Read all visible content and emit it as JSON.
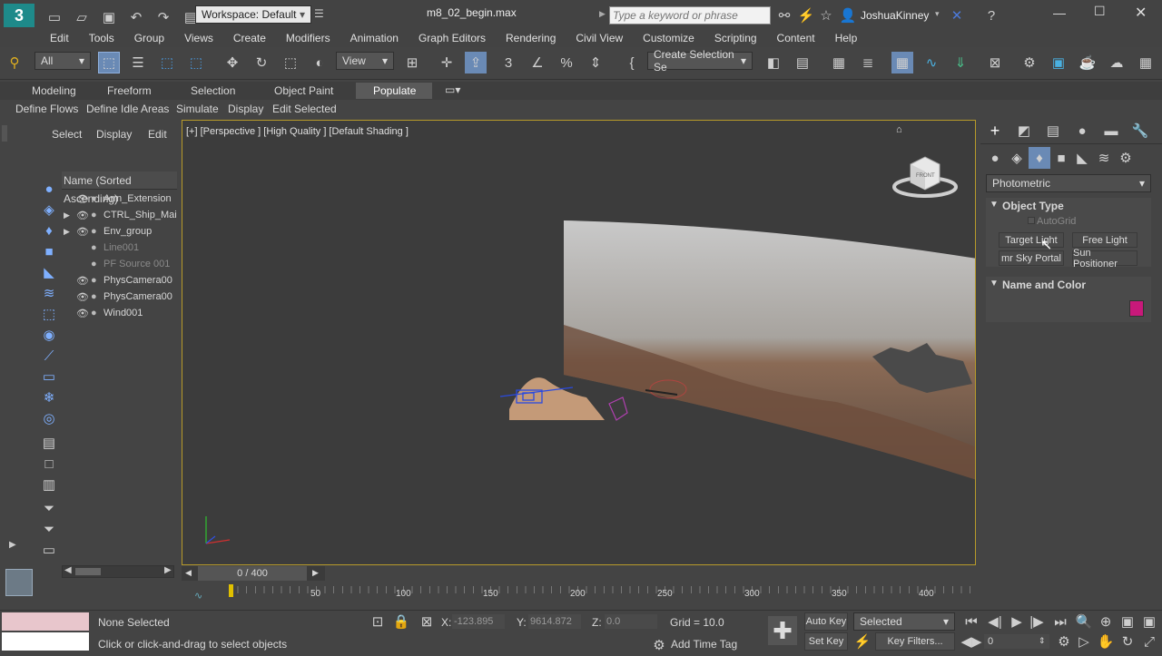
{
  "titlebar": {
    "workspace": "Workspace: Default",
    "file_title": "m8_02_begin.max",
    "search_placeholder": "Type a keyword or phrase",
    "user": "JoshuaKinney"
  },
  "menu": [
    "Edit",
    "Tools",
    "Group",
    "Views",
    "Create",
    "Modifiers",
    "Animation",
    "Graph Editors",
    "Rendering",
    "Civil View",
    "Customize",
    "Scripting",
    "Content",
    "Help"
  ],
  "toolbar": {
    "filter": "All",
    "ref_coord": "View",
    "selection_set": "Create Selection Se"
  },
  "ribbon_tabs": [
    "Modeling",
    "Freeform",
    "Selection",
    "Object Paint",
    "Populate"
  ],
  "ribbon_tools": [
    "Define Flows",
    "Define Idle Areas",
    "Simulate",
    "Display",
    "Edit Selected"
  ],
  "scene_explorer": {
    "tabs": [
      "Select",
      "Display",
      "Edit"
    ],
    "header": "Name (Sorted Ascending)",
    "items": [
      {
        "name": "Arm_Extension",
        "expand": false,
        "dim": false
      },
      {
        "name": "CTRL_Ship_Mai",
        "expand": true,
        "dim": false
      },
      {
        "name": "Env_group",
        "expand": true,
        "dim": false
      },
      {
        "name": "Line001",
        "expand": false,
        "dim": true
      },
      {
        "name": "PF Source 001",
        "expand": false,
        "dim": true
      },
      {
        "name": "PhysCamera00",
        "expand": false,
        "dim": false
      },
      {
        "name": "PhysCamera00",
        "expand": false,
        "dim": false
      },
      {
        "name": "Wind001",
        "expand": false,
        "dim": false
      }
    ]
  },
  "viewport": {
    "label": "[+] [Perspective ] [High Quality ] [Default Shading ]",
    "viewcube_label": "FRONT"
  },
  "command_panel": {
    "category": "Photometric",
    "object_type_title": "Object Type",
    "autogrid": "AutoGrid",
    "buttons": [
      "Target Light",
      "Free Light",
      "mr Sky Portal",
      "Sun Positioner"
    ],
    "name_color_title": "Name and Color",
    "swatch_color": "#c8197a"
  },
  "timeline": {
    "frame": "0 / 400",
    "ticks": [
      "50",
      "100",
      "150",
      "200",
      "250",
      "300",
      "350",
      "400"
    ]
  },
  "status": {
    "selection": "None Selected",
    "prompt": "Click or click-and-drag to select objects",
    "x_label": "X:",
    "x_value": "-123.895",
    "y_label": "Y:",
    "y_value": "9614.872",
    "z_label": "Z:",
    "z_value": "0.0",
    "grid": "Grid = 10.0",
    "add_time_tag": "Add Time Tag",
    "auto_key": "Auto Key",
    "set_key": "Set Key",
    "key_mode": "Selected",
    "key_filters": "Key Filters...",
    "current_frame": "0"
  }
}
